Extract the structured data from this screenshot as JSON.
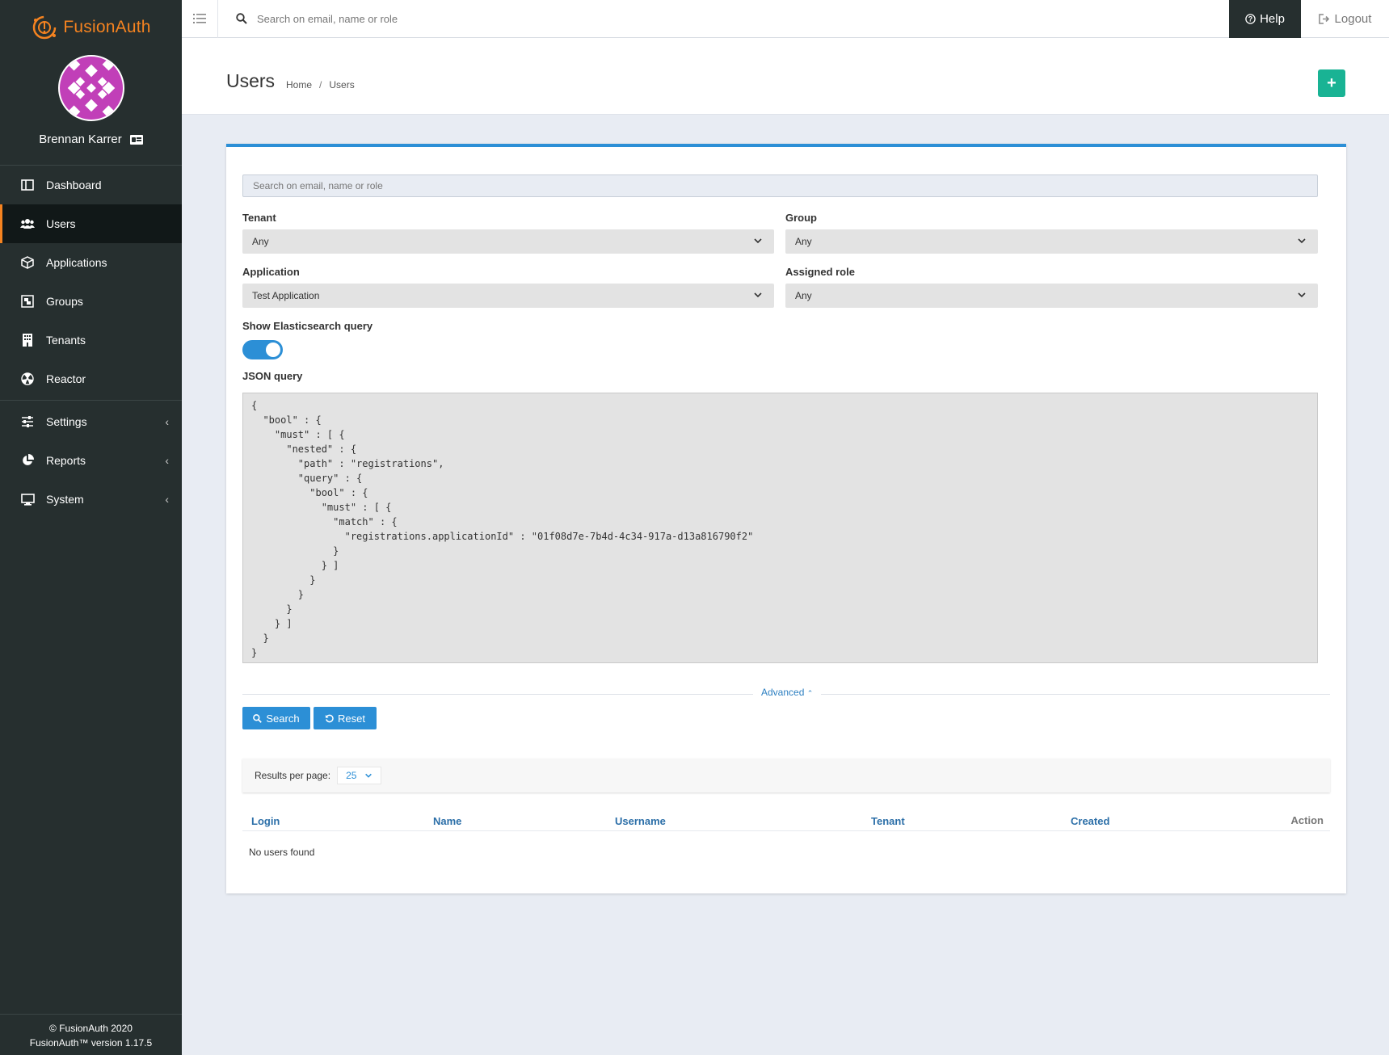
{
  "brand": {
    "name": "FusionAuth"
  },
  "user": {
    "name": "Brennan Karrer"
  },
  "nav": {
    "items": [
      {
        "label": "Dashboard",
        "icon": "dashboard-icon"
      },
      {
        "label": "Users",
        "icon": "users-icon"
      },
      {
        "label": "Applications",
        "icon": "cube-icon"
      },
      {
        "label": "Groups",
        "icon": "groups-icon"
      },
      {
        "label": "Tenants",
        "icon": "building-icon"
      },
      {
        "label": "Reactor",
        "icon": "reactor-icon"
      },
      {
        "label": "Settings",
        "icon": "sliders-icon"
      },
      {
        "label": "Reports",
        "icon": "pie-chart-icon"
      },
      {
        "label": "System",
        "icon": "monitor-icon"
      }
    ],
    "active": "Users"
  },
  "footer": {
    "copyright": "© FusionAuth 2020",
    "version": "FusionAuth™ version 1.17.5"
  },
  "topbar": {
    "search_placeholder": "Search on email, name or role",
    "help_label": "Help",
    "logout_label": "Logout"
  },
  "header": {
    "title": "Users",
    "breadcrumb": [
      "Home",
      "Users"
    ]
  },
  "search": {
    "placeholder": "Search on email, name or role",
    "tenant": {
      "label": "Tenant",
      "value": "Any"
    },
    "group": {
      "label": "Group",
      "value": "Any"
    },
    "application": {
      "label": "Application",
      "value": "Test Application"
    },
    "role": {
      "label": "Assigned role",
      "value": "Any"
    },
    "es_toggle_label": "Show Elasticsearch query",
    "es_toggle_on": true,
    "json_label": "JSON query",
    "json_query": "{\n  \"bool\" : {\n    \"must\" : [ {\n      \"nested\" : {\n        \"path\" : \"registrations\",\n        \"query\" : {\n          \"bool\" : {\n            \"must\" : [ {\n              \"match\" : {\n                \"registrations.applicationId\" : \"01f08d7e-7b4d-4c34-917a-d13a816790f2\"\n              }\n            } ]\n          }\n        }\n      }\n    } ]\n  }\n}",
    "advanced_label": "Advanced",
    "search_button": "Search",
    "reset_button": "Reset"
  },
  "results": {
    "per_page_label": "Results per page:",
    "per_page_value": "25",
    "columns": [
      "Login",
      "Name",
      "Username",
      "Tenant",
      "Created",
      "Action"
    ],
    "empty_text": "No users found"
  },
  "colors": {
    "sidebar_bg": "#262f2f",
    "brand_orange": "#f58320",
    "accent_blue": "#2c8fd6",
    "add_green": "#19b394"
  }
}
